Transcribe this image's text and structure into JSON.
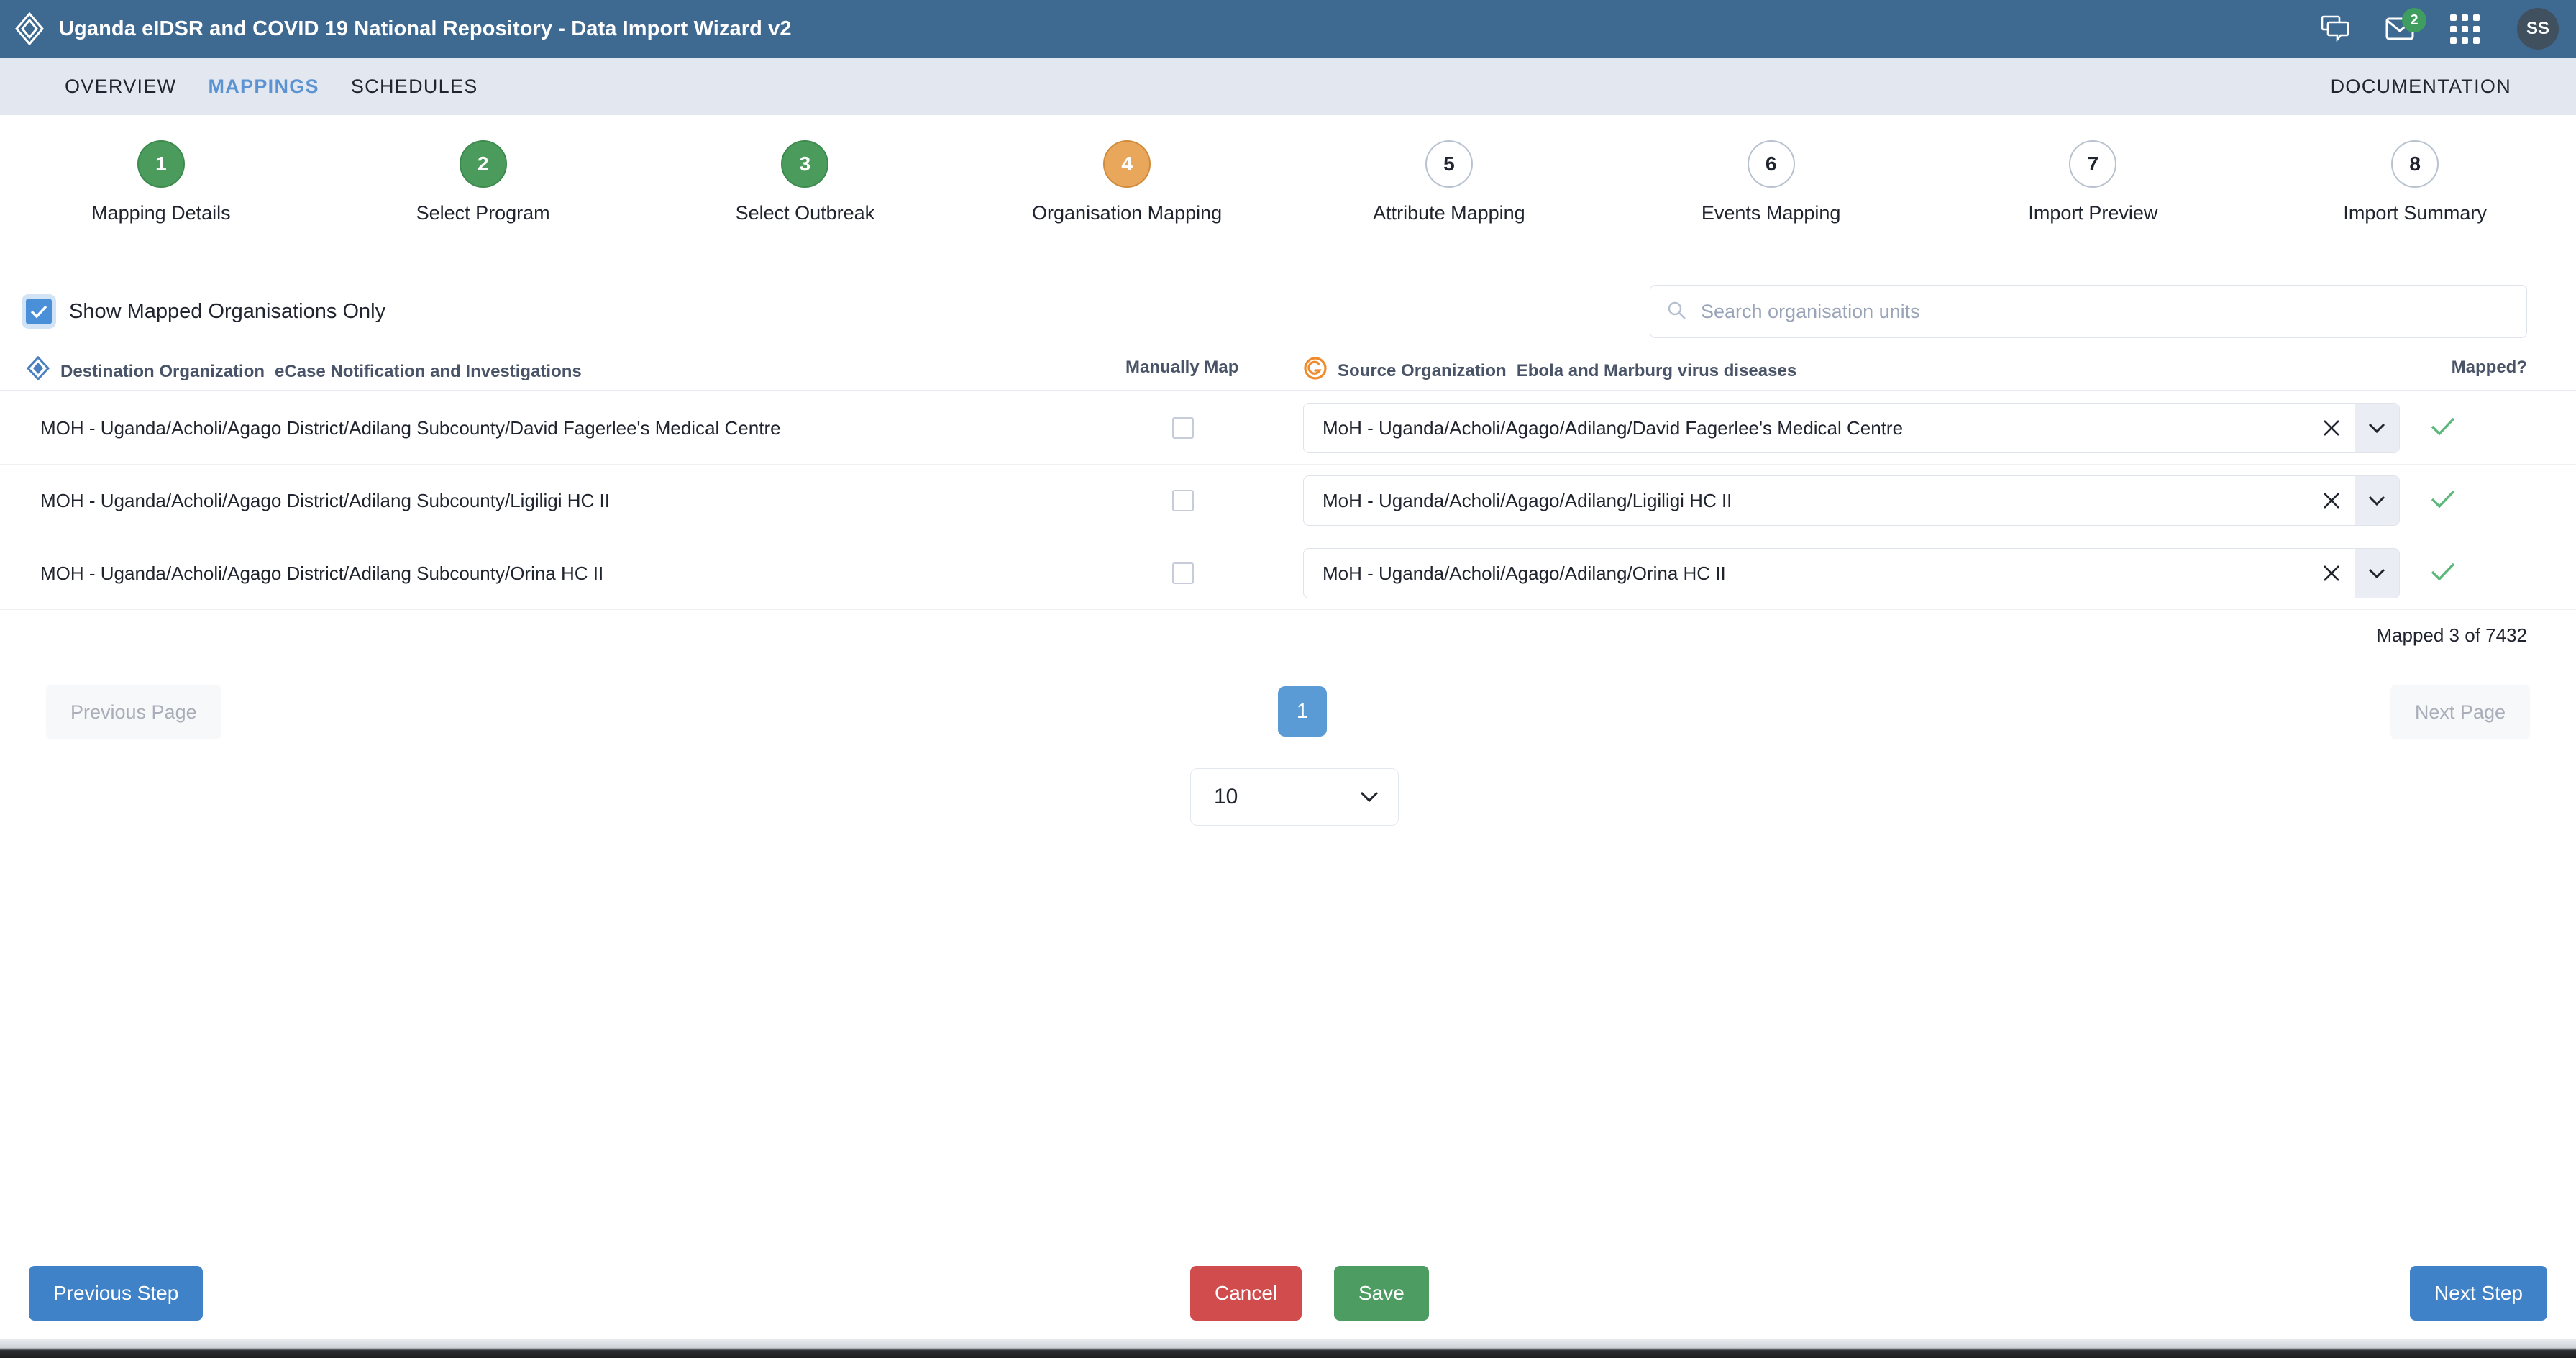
{
  "header": {
    "title": "Uganda eIDSR and COVID 19 National Repository - Data Import Wizard v2",
    "logo_icon": "layers-diamond-icon",
    "chat_icon": "chat-bubbles-icon",
    "mail_icon": "envelope-icon",
    "mail_badge": "2",
    "apps_icon": "apps-grid-icon",
    "avatar_initials": "SS",
    "bg_color": "#3e6a92"
  },
  "nav": {
    "tabs": [
      {
        "label": "OVERVIEW",
        "active": false
      },
      {
        "label": "MAPPINGS",
        "active": true
      },
      {
        "label": "SCHEDULES",
        "active": false
      }
    ],
    "right_link": "DOCUMENTATION",
    "active_color": "#5b93d3"
  },
  "stepper": {
    "steps": [
      {
        "number": "1",
        "label": "Mapping Details",
        "state": "done"
      },
      {
        "number": "2",
        "label": "Select Program",
        "state": "done"
      },
      {
        "number": "3",
        "label": "Select Outbreak",
        "state": "done"
      },
      {
        "number": "4",
        "label": "Organisation Mapping",
        "state": "current"
      },
      {
        "number": "5",
        "label": "Attribute Mapping",
        "state": "todo"
      },
      {
        "number": "6",
        "label": "Events Mapping",
        "state": "todo"
      },
      {
        "number": "7",
        "label": "Import Preview",
        "state": "todo"
      },
      {
        "number": "8",
        "label": "Import Summary",
        "state": "todo"
      }
    ],
    "done_color": "#4a9b5c",
    "current_color": "#e8a75a"
  },
  "filters": {
    "show_mapped_label": "Show Mapped Organisations Only",
    "show_mapped_checked": true,
    "checkbox_color": "#4a90d9",
    "search_placeholder": "Search organisation units",
    "search_value": "",
    "search_icon": "magnifier-icon"
  },
  "table": {
    "headers": {
      "destination_title": "Destination Organization",
      "destination_subtitle": "eCase Notification and Investigations",
      "destination_icon": "dhis2-diamond-icon",
      "manually_map": "Manually Map",
      "source_title": "Source Organization",
      "source_subtitle": "Ebola and Marburg virus diseases",
      "source_icon": "godata-circle-icon",
      "mapped": "Mapped?"
    },
    "rows": [
      {
        "destination": "MOH - Uganda/Acholi/Agago District/Adilang Subcounty/David Fagerlee's Medical Centre",
        "manual_checked": false,
        "source": "MoH - Uganda/Acholi/Agago/Adilang/David Fagerlee's Medical Centre",
        "clear_icon": "close-x-icon",
        "caret_icon": "chevron-down-icon",
        "mapped": true,
        "mapped_icon": "check-icon"
      },
      {
        "destination": "MOH - Uganda/Acholi/Agago District/Adilang Subcounty/Ligiligi HC II",
        "manual_checked": false,
        "source": "MoH - Uganda/Acholi/Agago/Adilang/Ligiligi HC II",
        "clear_icon": "close-x-icon",
        "caret_icon": "chevron-down-icon",
        "mapped": true,
        "mapped_icon": "check-icon"
      },
      {
        "destination": "MOH - Uganda/Acholi/Agago District/Adilang Subcounty/Orina HC II",
        "manual_checked": false,
        "source": "MoH - Uganda/Acholi/Agago/Adilang/Orina HC II",
        "clear_icon": "close-x-icon",
        "caret_icon": "chevron-down-icon",
        "mapped": true,
        "mapped_icon": "check-icon"
      }
    ],
    "mapped_count": "Mapped 3 of 7432",
    "check_color": "#5cb87a"
  },
  "pagination": {
    "previous_label": "Previous Page",
    "next_label": "Next Page",
    "pages": [
      "1"
    ],
    "current_page": "1",
    "page_size": "10",
    "page_size_caret": "chevron-down-icon",
    "active_page_color": "#5b9bd5"
  },
  "footer": {
    "previous_step": "Previous Step",
    "cancel": "Cancel",
    "save": "Save",
    "next_step": "Next Step",
    "primary_color": "#3f82c7",
    "cancel_color": "#d14d4d",
    "save_color": "#4d9d63"
  }
}
